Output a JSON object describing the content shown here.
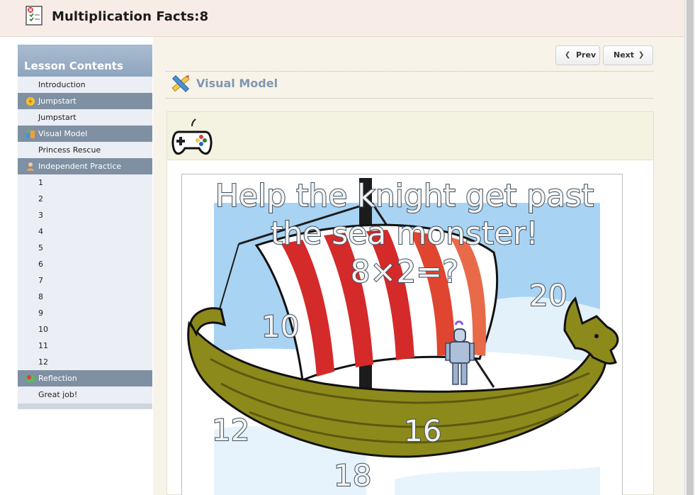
{
  "app": {
    "title": "Multiplication Facts:8"
  },
  "nav": {
    "prev_label": "Prev",
    "next_label": "Next"
  },
  "sidebar": {
    "heading": "Lesson Contents",
    "sections": [
      {
        "type": "item",
        "label": "Introduction"
      },
      {
        "type": "section",
        "label": "Jumpstart",
        "icon": "lightning-icon"
      },
      {
        "type": "item",
        "label": "Jumpstart"
      },
      {
        "type": "section",
        "label": "Visual Model",
        "icon": "visual-model-icon"
      },
      {
        "type": "item",
        "label": "Princess Rescue"
      },
      {
        "type": "section",
        "label": "Independent Practice",
        "icon": "student-icon"
      },
      {
        "type": "item",
        "label": "1"
      },
      {
        "type": "item",
        "label": "2"
      },
      {
        "type": "item",
        "label": "3"
      },
      {
        "type": "item",
        "label": "4"
      },
      {
        "type": "item",
        "label": "5"
      },
      {
        "type": "item",
        "label": "6"
      },
      {
        "type": "item",
        "label": "7"
      },
      {
        "type": "item",
        "label": "8"
      },
      {
        "type": "item",
        "label": "9"
      },
      {
        "type": "item",
        "label": "10"
      },
      {
        "type": "item",
        "label": "11"
      },
      {
        "type": "item",
        "label": "12"
      },
      {
        "type": "section",
        "label": "Reflection",
        "icon": "reflection-icon"
      },
      {
        "type": "item",
        "label": "Great job!"
      }
    ]
  },
  "main": {
    "section_title": "Visual Model",
    "game": {
      "prompt_line1": "Help the knight get past",
      "prompt_line2": "the sea monster!",
      "prompt_line3": "8×2=?",
      "answers": [
        "10",
        "20",
        "12",
        "16",
        "18"
      ]
    }
  },
  "colors": {
    "header_bg": "#f7ede6",
    "sidebar_section": "#7f90a3",
    "section_title": "#7f97b1",
    "sky": "#a9d3f3"
  }
}
